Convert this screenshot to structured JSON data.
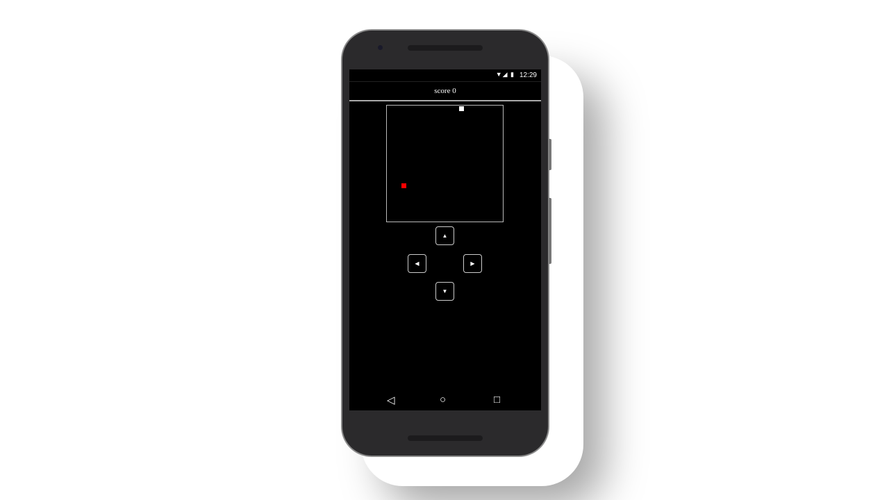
{
  "status_bar": {
    "time": "12:29",
    "icons": [
      "wifi-icon",
      "signal-icon",
      "battery-icon"
    ]
  },
  "header": {
    "score_text": "score 0"
  },
  "game": {
    "grid_size": 24,
    "snake": [
      {
        "col": 15,
        "row": 0
      }
    ],
    "food": {
      "col": 3,
      "row": 16
    },
    "snake_color": "#ffffff",
    "food_color": "#ff0000"
  },
  "controls": {
    "up": "▲",
    "left": "◀",
    "right": "▶",
    "down": "▼"
  },
  "nav": {
    "back": "◁",
    "home": "○",
    "recents": "□"
  }
}
